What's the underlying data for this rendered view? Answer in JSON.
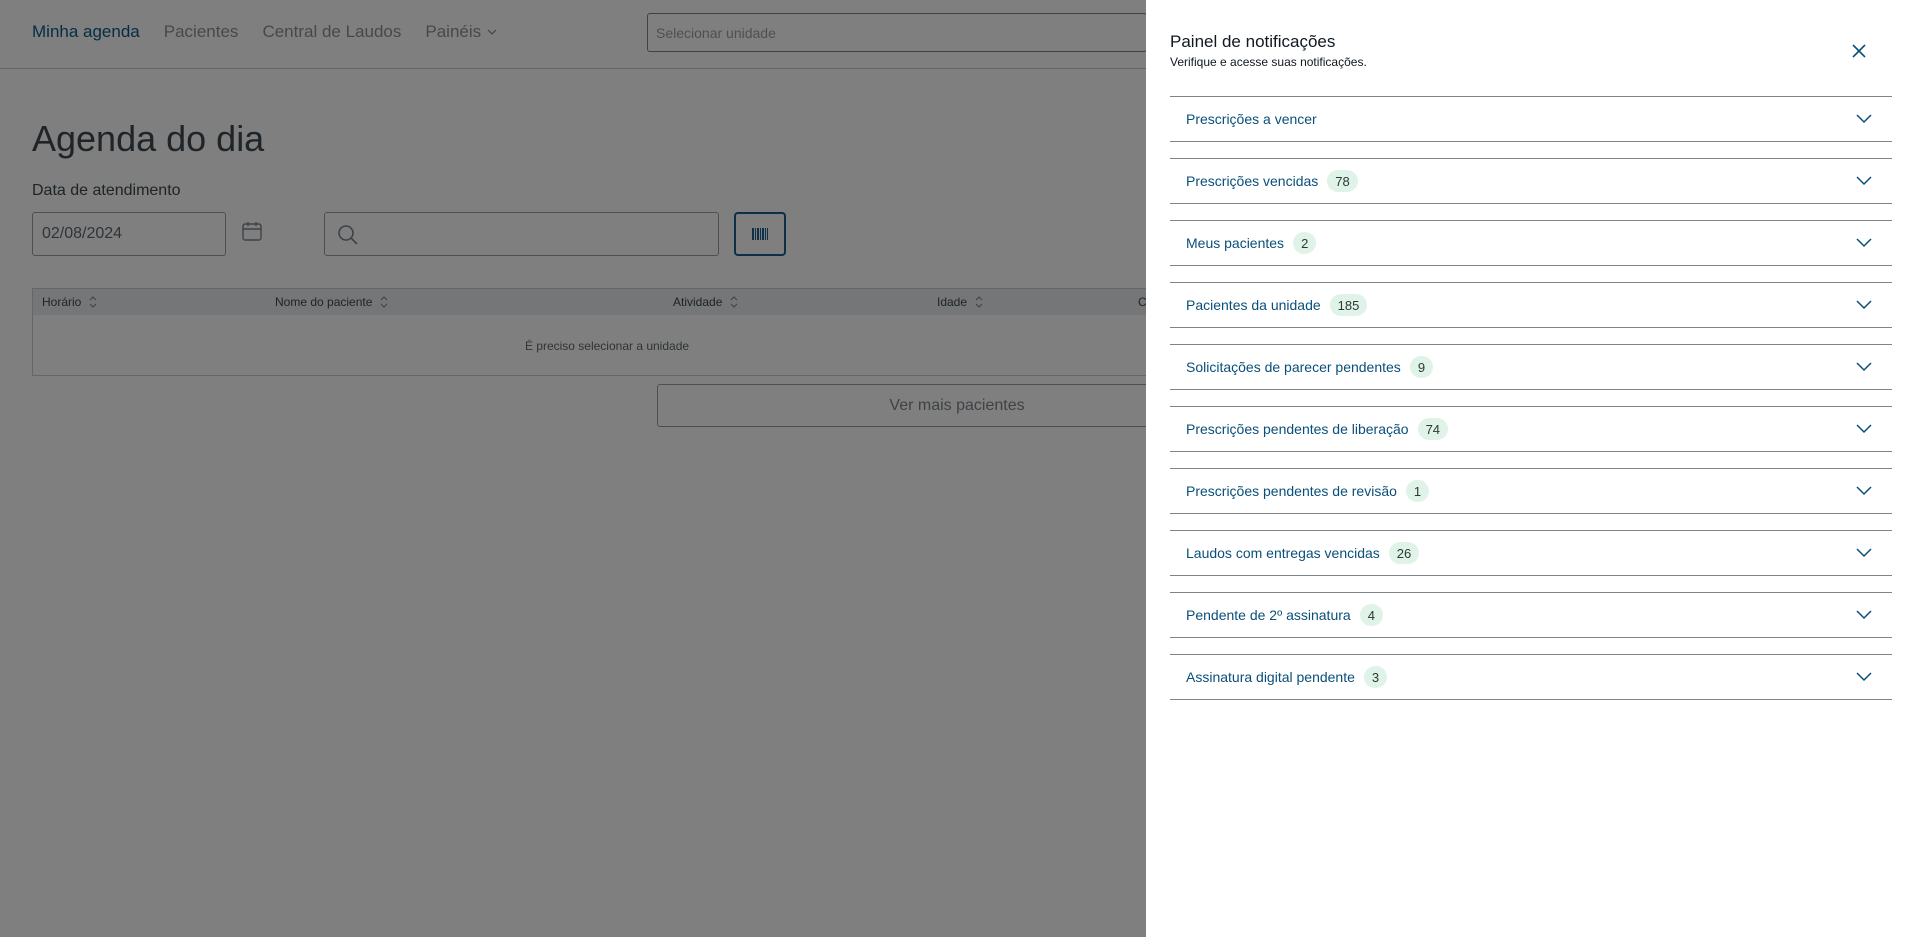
{
  "nav": {
    "items": [
      {
        "label": "Minha agenda",
        "active": true
      },
      {
        "label": "Pacientes",
        "active": false
      },
      {
        "label": "Central de Laudos",
        "active": false
      },
      {
        "label": "Painéis",
        "active": false
      }
    ]
  },
  "unit_select": {
    "placeholder": "Selecionar unidade"
  },
  "page": {
    "title": "Agenda do dia",
    "date_label": "Data de atendimento",
    "date_value": "02/08/2024"
  },
  "table": {
    "headers": [
      "Horário",
      "Nome do paciente",
      "Atividade",
      "Idade",
      "C"
    ],
    "empty_message": "É preciso selecionar a unidade"
  },
  "more_button": {
    "label": "Ver mais pacientes"
  },
  "drawer": {
    "title": "Painel de notificações",
    "subtitle": "Verifique e acesse suas notificações.",
    "items": [
      {
        "label": "Prescrições a vencer",
        "count": ""
      },
      {
        "label": "Prescrições vencidas",
        "count": "78"
      },
      {
        "label": "Meus pacientes",
        "count": "2"
      },
      {
        "label": "Pacientes da unidade",
        "count": "185"
      },
      {
        "label": "Solicitações de parecer pendentes",
        "count": "9"
      },
      {
        "label": "Prescrições pendentes de liberação",
        "count": "74"
      },
      {
        "label": "Prescrições pendentes de revisão",
        "count": "1"
      },
      {
        "label": "Laudos com entregas vencidas",
        "count": "26"
      },
      {
        "label": "Pendente de 2º assinatura",
        "count": "4"
      },
      {
        "label": "Assinatura digital pendente",
        "count": "3"
      }
    ]
  },
  "colors": {
    "accent": "#0a4f7a",
    "badge_bg": "#dff3e8",
    "overlay": "#000000"
  }
}
